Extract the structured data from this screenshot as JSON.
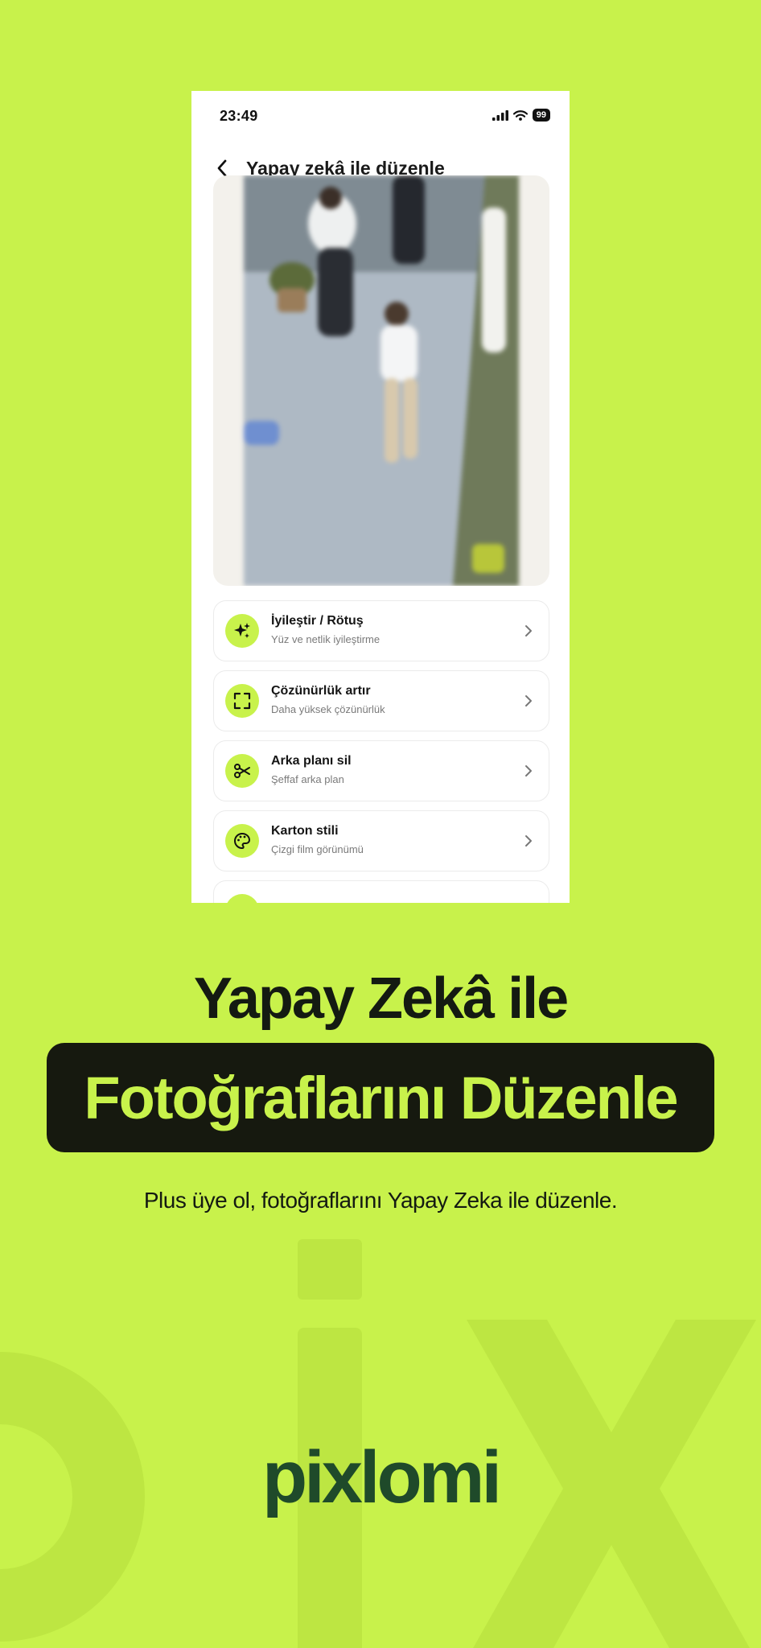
{
  "phone": {
    "status_time": "23:49",
    "battery_level": "99",
    "header_title": "Yapay zekâ ile düzenle",
    "menu_items": [
      {
        "title": "İyileştir / Rötuş",
        "subtitle": "Yüz ve netlik iyileştirme",
        "icon": "sparkles-icon"
      },
      {
        "title": "Çözünürlük artır",
        "subtitle": "Daha yüksek çözünürlük",
        "icon": "expand-frame-icon"
      },
      {
        "title": "Arka planı sil",
        "subtitle": "Şeffaf arka plan",
        "icon": "scissors-icon"
      },
      {
        "title": "Karton stili",
        "subtitle": "Çizgi film görünümü",
        "icon": "palette-icon"
      }
    ]
  },
  "promo": {
    "headline_line1": "Yapay Zekâ ile",
    "headline_line2": "Fotoğraflarını Düzenle",
    "subtext": "Plus üye ol, fotoğraflarını Yapay Zeka ile düzenle.",
    "logo_text": "pixlomi"
  },
  "colors": {
    "background": "#c8f24b",
    "accent": "#c8f24b",
    "dark": "#16190f",
    "logo": "#1f4a2a"
  }
}
